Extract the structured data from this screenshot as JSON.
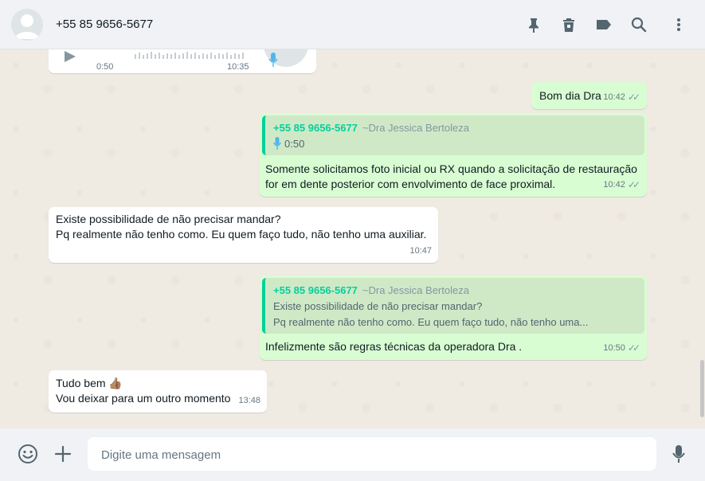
{
  "header": {
    "contact_name": "+55 85 9656-5677",
    "icons": [
      "pin-icon",
      "delete-icon",
      "label-icon",
      "search-icon",
      "menu-icon"
    ]
  },
  "messages": [
    {
      "id": "m0",
      "direction": "in",
      "type": "audio",
      "duration": "0:50",
      "time": "10:35"
    },
    {
      "id": "m1",
      "direction": "out",
      "text": "Bom dia Dra",
      "time": "10:42",
      "status": "read"
    },
    {
      "id": "m2",
      "direction": "out",
      "quote": {
        "author": "+55 85 9656-5677",
        "pushname": "~Dra Jessica Bertoleza",
        "audio_duration": "0:50"
      },
      "lines": [
        "Somente solicitamos foto inicial ou RX quando a solicitação de restauração",
        "for em dente posterior com envolvimento de face proximal."
      ],
      "time": "10:42",
      "status": "read"
    },
    {
      "id": "m3",
      "direction": "in",
      "lines": [
        "Existe possibilidade de não precisar mandar?",
        "Pq realmente não tenho como. Eu quem faço tudo, não tenho uma auxiliar."
      ],
      "time": "10:47"
    },
    {
      "id": "m4",
      "direction": "out",
      "quote": {
        "author": "+55 85 9656-5677",
        "pushname": "~Dra Jessica Bertoleza",
        "lines": [
          "Existe possibilidade de não precisar mandar?",
          "Pq realmente não tenho como. Eu quem faço tudo, não tenho uma..."
        ]
      },
      "text": "Infelizmente são regras técnicas da operadora Dra .",
      "time": "10:50",
      "status": "read"
    },
    {
      "id": "m5",
      "direction": "in",
      "lines": [
        "Tudo bem 👍🏽",
        "Vou deixar para um outro momento"
      ],
      "time": "13:48"
    }
  ],
  "composer": {
    "placeholder": "Digite uma mensagem",
    "icons": [
      "emoji-icon",
      "attach-plus-icon",
      "microphone-icon"
    ]
  },
  "colors": {
    "outgoing": "#d9fdd3",
    "incoming": "#ffffff",
    "accent": "#06cf9c",
    "background": "#efeae2"
  }
}
